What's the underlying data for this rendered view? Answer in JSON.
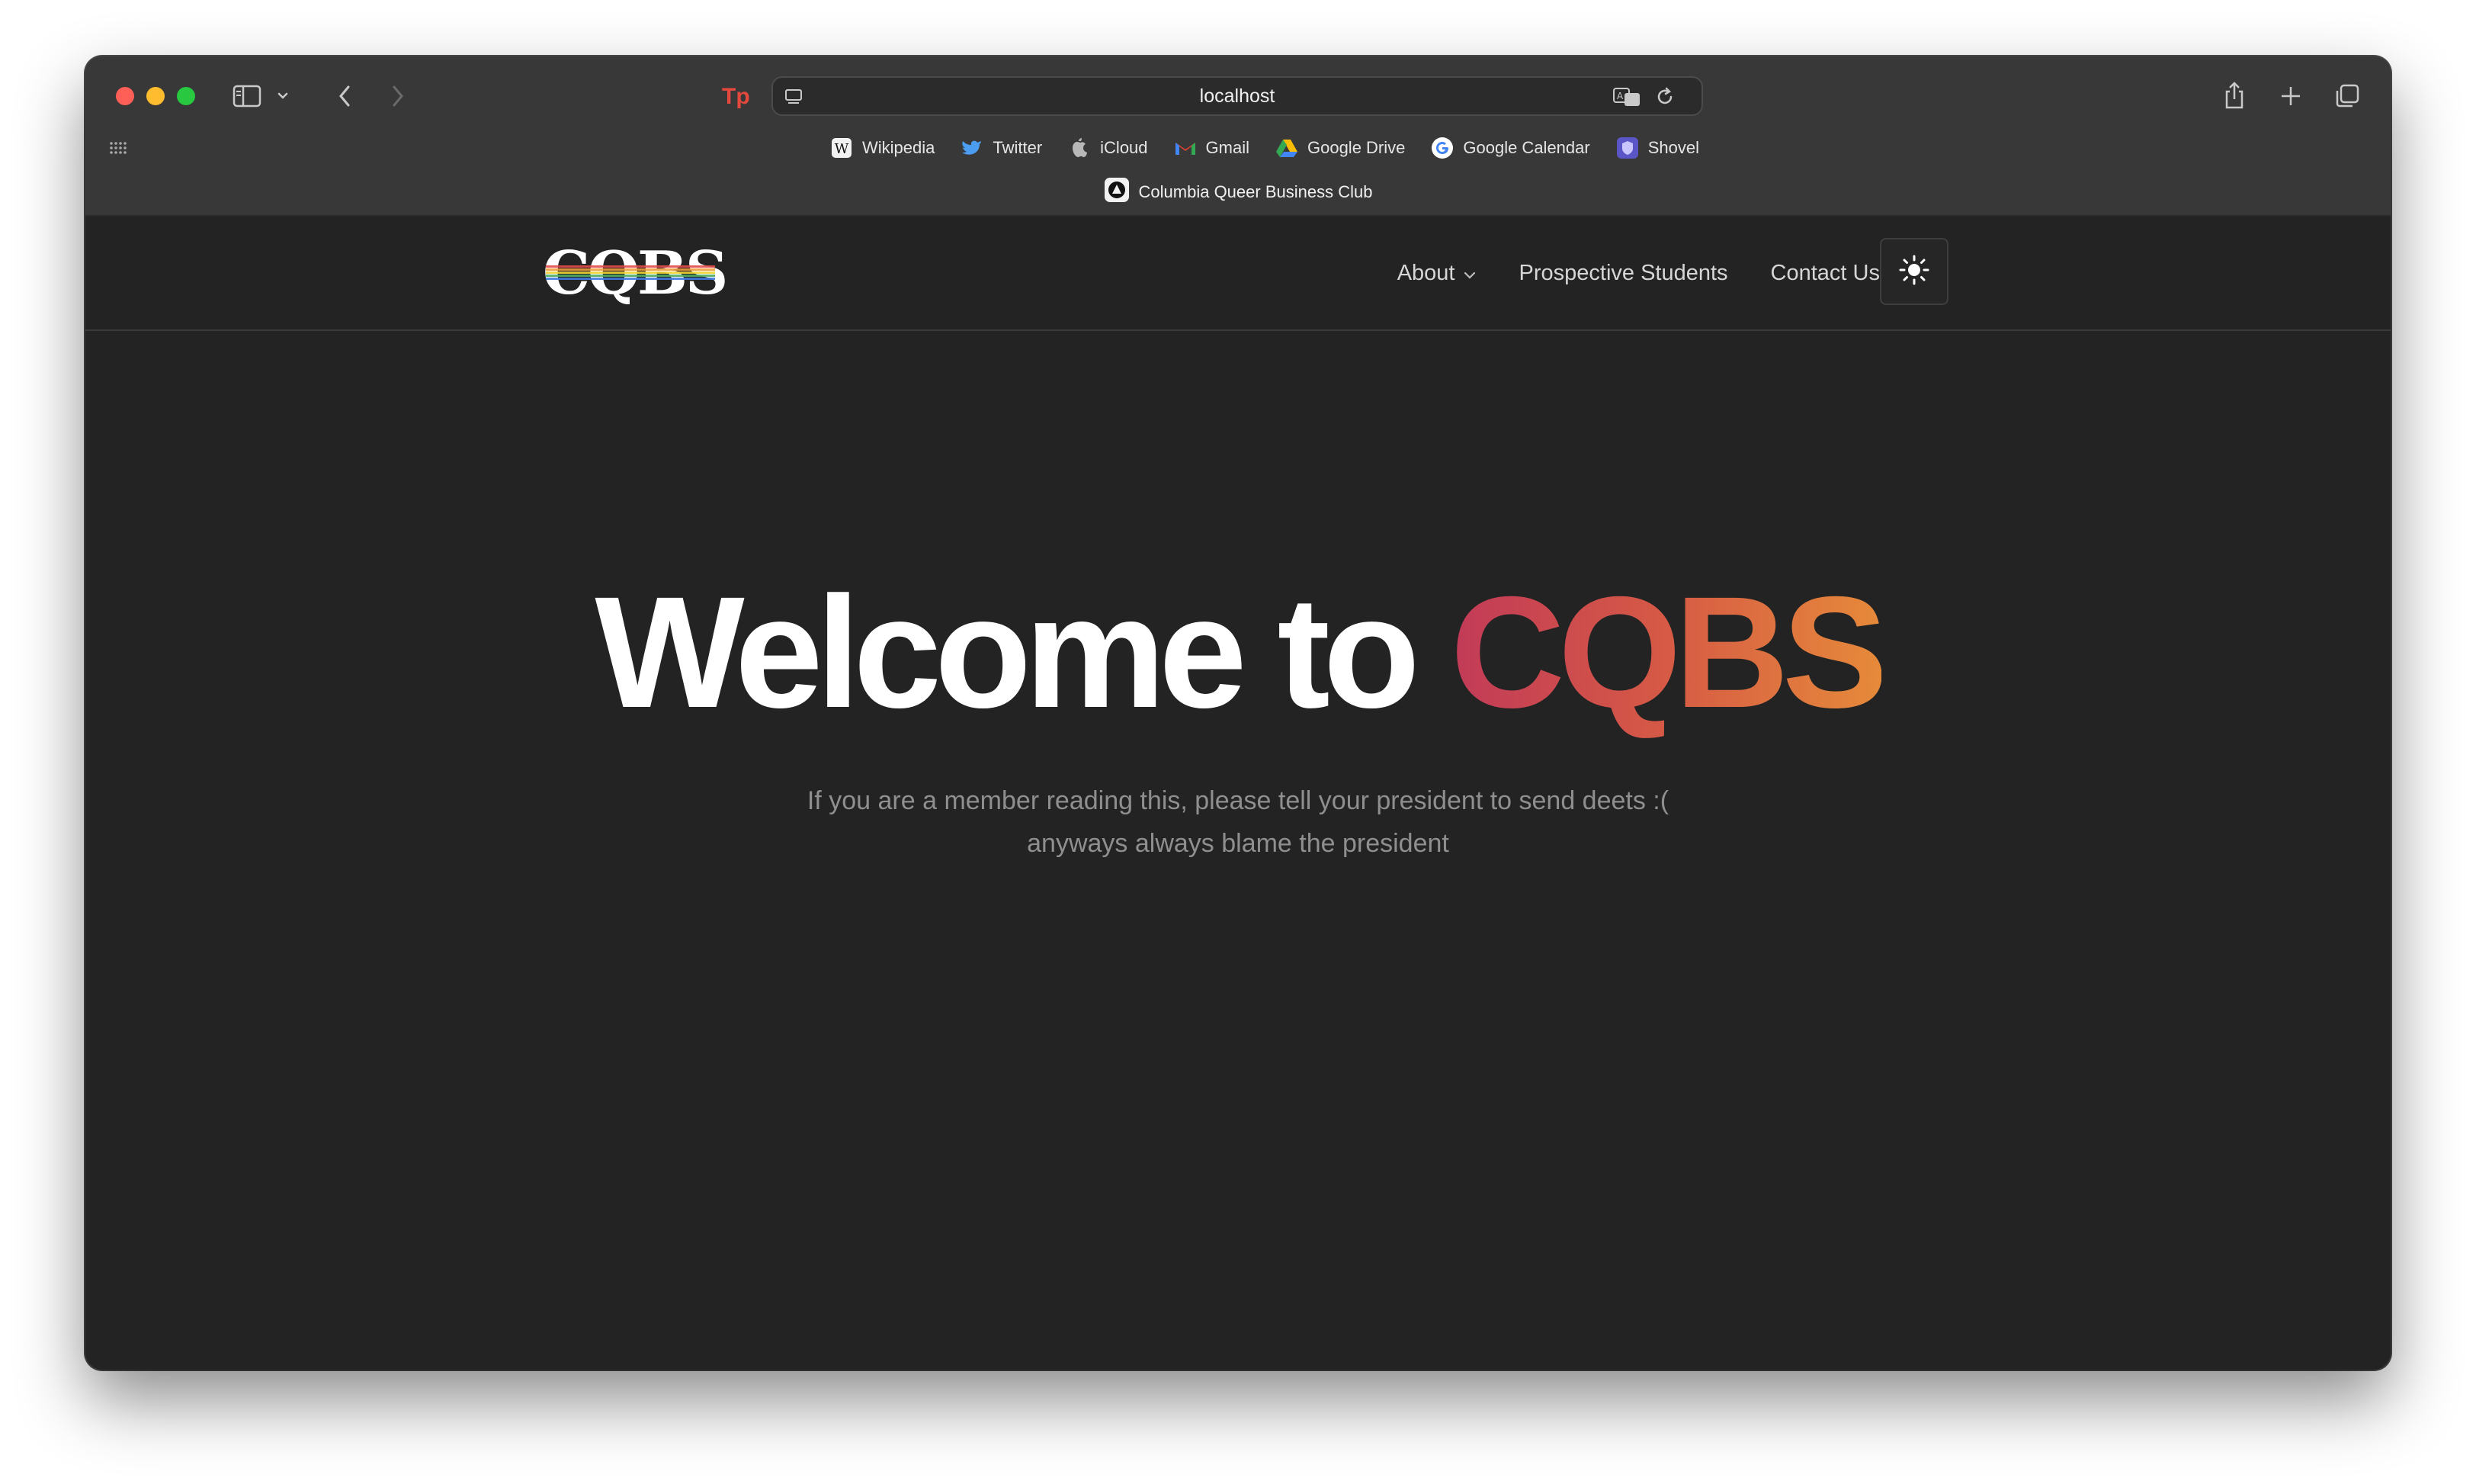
{
  "browser": {
    "url": "localhost",
    "bookmarks": [
      {
        "label": "Wikipedia",
        "icon": "wikipedia-icon"
      },
      {
        "label": "Twitter",
        "icon": "twitter-icon"
      },
      {
        "label": "iCloud",
        "icon": "apple-icon"
      },
      {
        "label": "Gmail",
        "icon": "gmail-icon"
      },
      {
        "label": "Google Drive",
        "icon": "google-drive-icon"
      },
      {
        "label": "Google Calendar",
        "icon": "google-icon"
      },
      {
        "label": "Shovel",
        "icon": "shovel-icon"
      }
    ],
    "tab_title": "Columbia Queer Business Club"
  },
  "site": {
    "logo_text": "CQBS",
    "nav": {
      "about": "About",
      "prospective": "Prospective Students",
      "contact": "Contact Us"
    },
    "hero": {
      "title_prefix": "Welcome to ",
      "title_accent": "CQBS",
      "subtitle_line1": "If you are a member reading this, please tell your president to send deets :(",
      "subtitle_line2": "anyways always blame the president"
    }
  },
  "colors": {
    "accent_start": "#c23a58",
    "accent_end": "#e68a3a",
    "background": "#232323"
  }
}
